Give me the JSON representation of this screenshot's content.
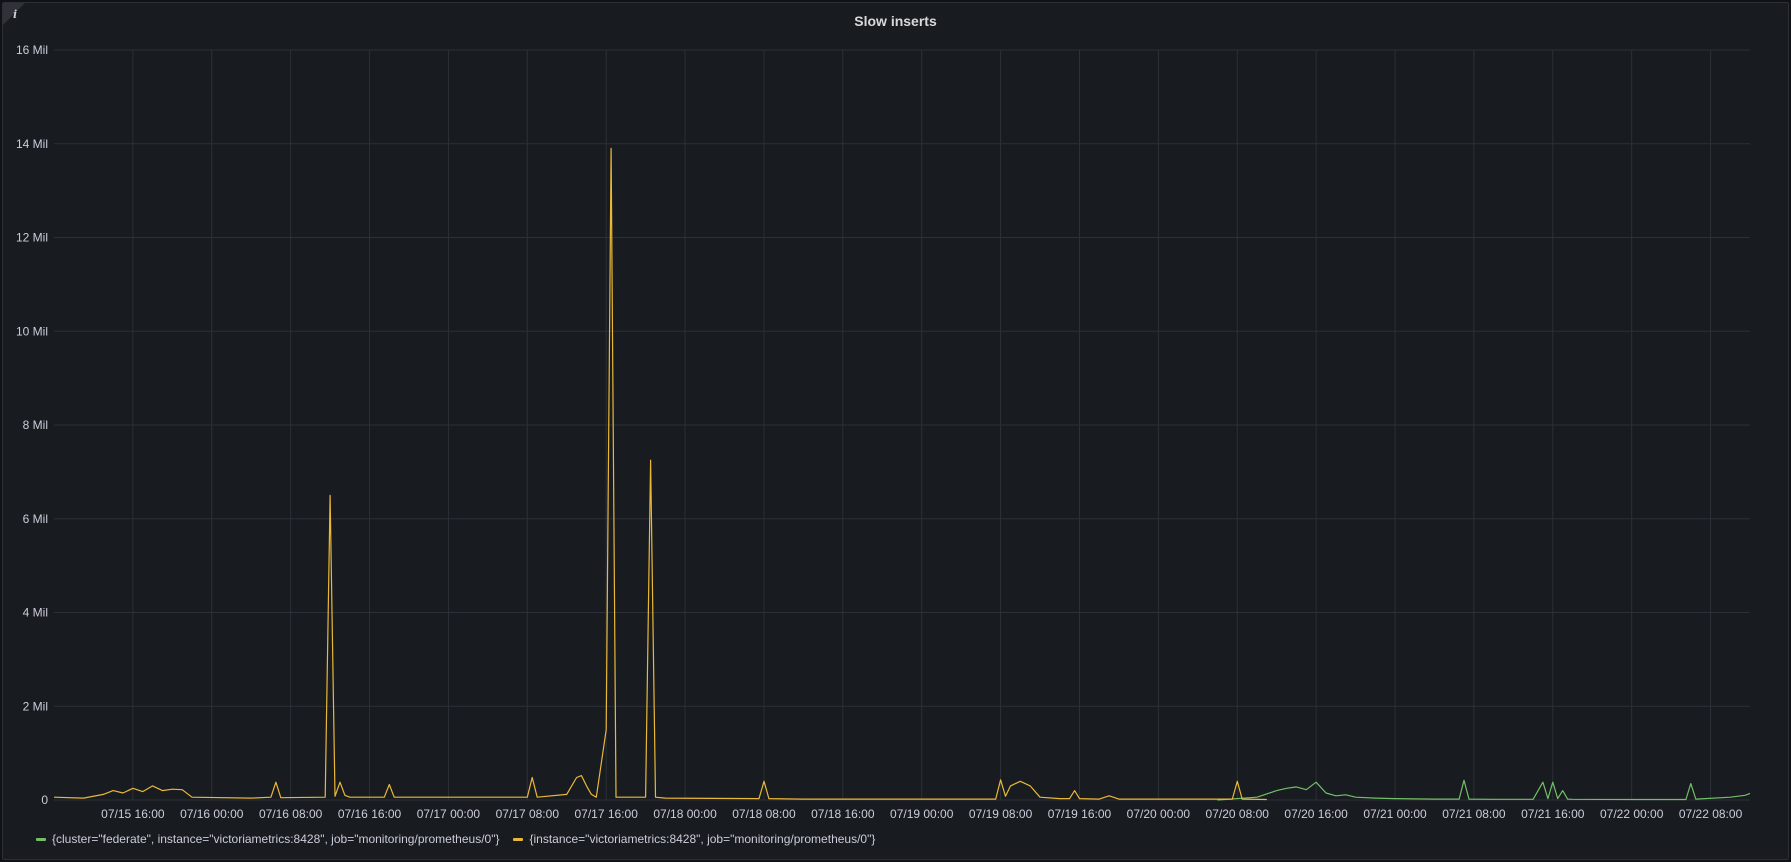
{
  "panel": {
    "title": "Slow inserts",
    "info_icon": "info-icon",
    "info_glyph": "i"
  },
  "chart_data": {
    "type": "line",
    "title": "Slow inserts",
    "xlabel": "",
    "ylabel": "",
    "grid": true,
    "legend_position": "bottom-left",
    "x_range": [
      "07/15 08:00",
      "07/22 12:00"
    ],
    "ylim": [
      0,
      16000000
    ],
    "y_ticks": [
      {
        "value": 0,
        "label": "0"
      },
      {
        "value": 2000000,
        "label": "2 Mil"
      },
      {
        "value": 4000000,
        "label": "4 Mil"
      },
      {
        "value": 6000000,
        "label": "6 Mil"
      },
      {
        "value": 8000000,
        "label": "8 Mil"
      },
      {
        "value": 10000000,
        "label": "10 Mil"
      },
      {
        "value": 12000000,
        "label": "12 Mil"
      },
      {
        "value": 14000000,
        "label": "14 Mil"
      },
      {
        "value": 16000000,
        "label": "16 Mil"
      }
    ],
    "x_ticks": [
      {
        "value": "07/15 16:00",
        "label": "07/15 16:00"
      },
      {
        "value": "07/16 00:00",
        "label": "07/16 00:00"
      },
      {
        "value": "07/16 08:00",
        "label": "07/16 08:00"
      },
      {
        "value": "07/16 16:00",
        "label": "07/16 16:00"
      },
      {
        "value": "07/17 00:00",
        "label": "07/17 00:00"
      },
      {
        "value": "07/17 08:00",
        "label": "07/17 08:00"
      },
      {
        "value": "07/17 16:00",
        "label": "07/17 16:00"
      },
      {
        "value": "07/18 00:00",
        "label": "07/18 00:00"
      },
      {
        "value": "07/18 08:00",
        "label": "07/18 08:00"
      },
      {
        "value": "07/18 16:00",
        "label": "07/18 16:00"
      },
      {
        "value": "07/19 00:00",
        "label": "07/19 00:00"
      },
      {
        "value": "07/19 08:00",
        "label": "07/19 08:00"
      },
      {
        "value": "07/19 16:00",
        "label": "07/19 16:00"
      },
      {
        "value": "07/20 00:00",
        "label": "07/20 00:00"
      },
      {
        "value": "07/20 08:00",
        "label": "07/20 08:00"
      },
      {
        "value": "07/20 16:00",
        "label": "07/20 16:00"
      },
      {
        "value": "07/21 00:00",
        "label": "07/21 00:00"
      },
      {
        "value": "07/21 08:00",
        "label": "07/21 08:00"
      },
      {
        "value": "07/21 16:00",
        "label": "07/21 16:00"
      },
      {
        "value": "07/22 00:00",
        "label": "07/22 00:00"
      },
      {
        "value": "07/22 08:00",
        "label": "07/22 08:00"
      }
    ],
    "series": [
      {
        "name": "{cluster=\"federate\", instance=\"victoriametrics:8428\", job=\"monitoring/prometheus/0\"}",
        "color": "#73bf69",
        "x": [
          "07/20 06:00",
          "07/20 10:00",
          "07/20 12:00",
          "07/20 13:00",
          "07/20 14:00",
          "07/20 15:00",
          "07/20 16:00",
          "07/20 17:00",
          "07/20 18:00",
          "07/20 19:00",
          "07/20 20:00",
          "07/20 22:00",
          "07/21 00:00",
          "07/21 04:00",
          "07/21 06:30",
          "07/21 07:00",
          "07/21 07:30",
          "07/21 10:00",
          "07/21 14:00",
          "07/21 15:00",
          "07/21 15:30",
          "07/21 16:00",
          "07/21 16:30",
          "07/21 17:00",
          "07/21 17:30",
          "07/21 18:00",
          "07/22 00:00",
          "07/22 05:30",
          "07/22 06:00",
          "07/22 06:30",
          "07/22 10:00",
          "07/22 11:30",
          "07/22 12:00"
        ],
        "y": [
          0,
          60000,
          200000,
          250000,
          280000,
          220000,
          380000,
          150000,
          90000,
          110000,
          60000,
          40000,
          30000,
          20000,
          20000,
          420000,
          20000,
          15000,
          15000,
          380000,
          30000,
          380000,
          30000,
          200000,
          20000,
          15000,
          10000,
          10000,
          350000,
          20000,
          60000,
          100000,
          140000
        ]
      },
      {
        "name": "{instance=\"victoriametrics:8428\", job=\"monitoring/prometheus/0\"}",
        "color": "#eab839",
        "x": [
          "07/15 08:00",
          "07/15 11:00",
          "07/15 13:00",
          "07/15 14:00",
          "07/15 15:00",
          "07/15 16:00",
          "07/15 17:00",
          "07/15 18:00",
          "07/15 19:00",
          "07/15 20:00",
          "07/15 21:00",
          "07/15 22:00",
          "07/16 04:00",
          "07/16 06:00",
          "07/16 06:30",
          "07/16 07:00",
          "07/16 11:30",
          "07/16 12:00",
          "07/16 12:30",
          "07/16 13:00",
          "07/16 13:30",
          "07/16 14:00",
          "07/16 17:30",
          "07/16 18:00",
          "07/16 18:30",
          "07/17 08:00",
          "07/17 08:30",
          "07/17 09:00",
          "07/17 12:00",
          "07/17 13:00",
          "07/17 13:30",
          "07/17 14:00",
          "07/17 14:30",
          "07/17 15:00",
          "07/17 16:00",
          "07/17 16:30",
          "07/17 17:00",
          "07/17 17:30",
          "07/17 20:00",
          "07/17 20:30",
          "07/17 21:00",
          "07/17 22:00",
          "07/18 07:30",
          "07/18 08:00",
          "07/18 08:30",
          "07/18 12:00",
          "07/19 07:30",
          "07/19 08:00",
          "07/19 08:30",
          "07/19 09:00",
          "07/19 10:00",
          "07/19 11:00",
          "07/19 12:00",
          "07/19 14:00",
          "07/19 15:00",
          "07/19 15:30",
          "07/19 16:00",
          "07/19 18:00",
          "07/19 19:00",
          "07/19 20:00",
          "07/20 07:30",
          "07/20 08:00",
          "07/20 08:30",
          "07/20 11:00"
        ],
        "y": [
          60000,
          40000,
          120000,
          200000,
          150000,
          250000,
          180000,
          300000,
          200000,
          230000,
          220000,
          60000,
          40000,
          60000,
          380000,
          50000,
          60000,
          6500000,
          80000,
          380000,
          100000,
          60000,
          60000,
          330000,
          60000,
          60000,
          480000,
          60000,
          120000,
          480000,
          520000,
          300000,
          120000,
          60000,
          1500000,
          13900000,
          60000,
          60000,
          60000,
          7250000,
          60000,
          40000,
          30000,
          400000,
          30000,
          20000,
          20000,
          430000,
          80000,
          300000,
          400000,
          300000,
          60000,
          30000,
          30000,
          200000,
          30000,
          20000,
          90000,
          20000,
          20000,
          400000,
          20000,
          10000
        ]
      }
    ]
  }
}
